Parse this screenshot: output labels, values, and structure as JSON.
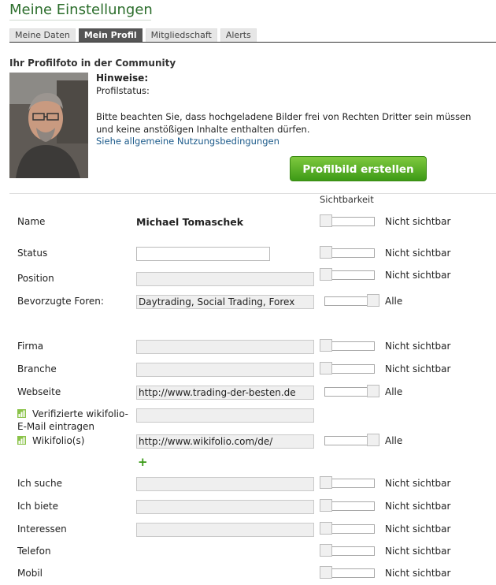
{
  "page": {
    "title": "Meine Einstellungen"
  },
  "tabs": [
    {
      "label": "Meine Daten",
      "active": false
    },
    {
      "label": "Mein Profil",
      "active": true
    },
    {
      "label": "Mitgliedschaft",
      "active": false
    },
    {
      "label": "Alerts",
      "active": false
    }
  ],
  "photo_section": {
    "title": "Ihr Profilfoto in der Community",
    "hint_label": "Hinweise:",
    "status_label": "Profilstatus:",
    "notice": "Bitte beachten Sie, dass hochgeladene Bilder frei von Rechten Dritter sein müssen und keine anstößigen Inhalte enthalten dürfen.",
    "terms_link": "Siehe allgemeine Nutzungsbedingungen",
    "create_button": "Profilbild erstellen"
  },
  "visibility_header": "Sichtbarkeit",
  "visibility_labels": {
    "hidden": "Nicht sichtbar",
    "all": "Alle"
  },
  "fields": {
    "name": {
      "label": "Name",
      "value": "Michael Tomaschek",
      "visibility": "Nicht sichtbar"
    },
    "status": {
      "label": "Status",
      "value": "",
      "visibility": "Nicht sichtbar"
    },
    "position": {
      "label": "Position",
      "value": "",
      "visibility": "Nicht sichtbar"
    },
    "foren": {
      "label": "Bevorzugte Foren:",
      "value": "Daytrading, Social Trading, Forex",
      "visibility": "Alle"
    },
    "firma": {
      "label": "Firma",
      "value": "",
      "visibility": "Nicht sichtbar"
    },
    "branche": {
      "label": "Branche",
      "value": "",
      "visibility": "Nicht sichtbar"
    },
    "webseite": {
      "label": "Webseite",
      "value": "http://www.trading-der-besten.de",
      "visibility": "Alle"
    },
    "wikifolio_email": {
      "label_line1": "Verifizierte wikifolio-",
      "label_line2": "E-Mail eintragen",
      "value": ""
    },
    "wikifolios": {
      "label": "Wikifolio(s)",
      "value": "http://www.wikifolio.com/de/",
      "visibility": "Alle",
      "add": "+"
    },
    "ich_suche": {
      "label": "Ich suche",
      "value": "",
      "visibility": "Nicht sichtbar"
    },
    "ich_biete": {
      "label": "Ich biete",
      "value": "",
      "visibility": "Nicht sichtbar"
    },
    "interessen": {
      "label": "Interessen",
      "value": "",
      "visibility": "Nicht sichtbar"
    },
    "telefon": {
      "label": "Telefon",
      "visibility": "Nicht sichtbar"
    },
    "mobil": {
      "label": "Mobil",
      "visibility": "Nicht sichtbar"
    }
  },
  "colors": {
    "title": "#2c6e2c",
    "button": "#4aa51c",
    "link": "#1b5a8a"
  }
}
